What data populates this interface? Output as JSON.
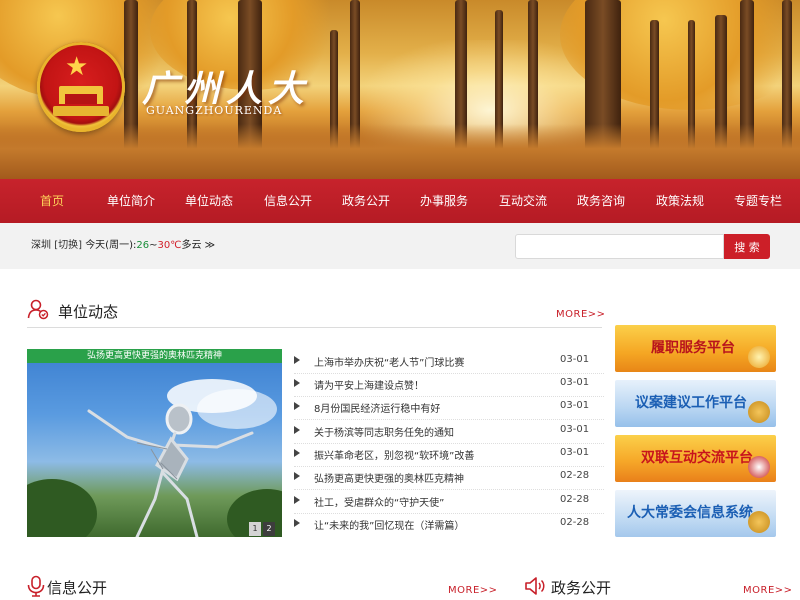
{
  "header": {
    "logo_title": "广州人大",
    "logo_subtitle": "GUANGZHOURENDA"
  },
  "nav": {
    "items": [
      "首页",
      "单位简介",
      "单位动态",
      "信息公开",
      "政务公开",
      "办事服务",
      "互动交流",
      "政务咨询",
      "政策法规",
      "专题专栏"
    ],
    "active_index": 0
  },
  "infobar": {
    "city": "深圳",
    "switch_label": "[切换]",
    "today_label": "今天(周一):",
    "temp_low": "26",
    "temp_sep": "~",
    "temp_high": "30℃",
    "condition": "多云",
    "more_arrow": "≫",
    "search_placeholder": "",
    "search_button": "搜 索"
  },
  "section_dynamics": {
    "title": "单位动态",
    "more": "MORE>>",
    "feature_caption": "弘扬更高更快更强的奥林匹克精神",
    "pager": [
      "1",
      "2"
    ],
    "news": [
      {
        "title": "上海市举办庆祝“老人节”门球比赛",
        "date": "03-01"
      },
      {
        "title": "请为平安上海建设点赞！",
        "date": "03-01"
      },
      {
        "title": "8月份国民经济运行稳中有好",
        "date": "03-01"
      },
      {
        "title": "关于杨滨等同志职务任免的通知",
        "date": "03-01"
      },
      {
        "title": "振兴革命老区，别忽视“软环境”改善",
        "date": "03-01"
      },
      {
        "title": "弘扬更高更快更强的奥林匹克精神",
        "date": "02-28"
      },
      {
        "title": "社工，受虐群众的“守护天使”",
        "date": "02-28"
      },
      {
        "title": "让“未来的我”回忆现在（洋需篇）",
        "date": "02-28"
      }
    ]
  },
  "side_banners": [
    {
      "label": "履职服务平台"
    },
    {
      "label": "议案建议工作平台"
    },
    {
      "label": "双联互动交流平台"
    },
    {
      "label": "人大常委会信息系统"
    }
  ],
  "section_info": {
    "title": "信息公开",
    "more": "MORE>>"
  },
  "section_gov": {
    "title": "政务公开",
    "more": "MORE>>"
  },
  "colors": {
    "brand_red": "#c7232c",
    "nav_active": "#ffd45a",
    "accent_green": "#2aa14a"
  }
}
